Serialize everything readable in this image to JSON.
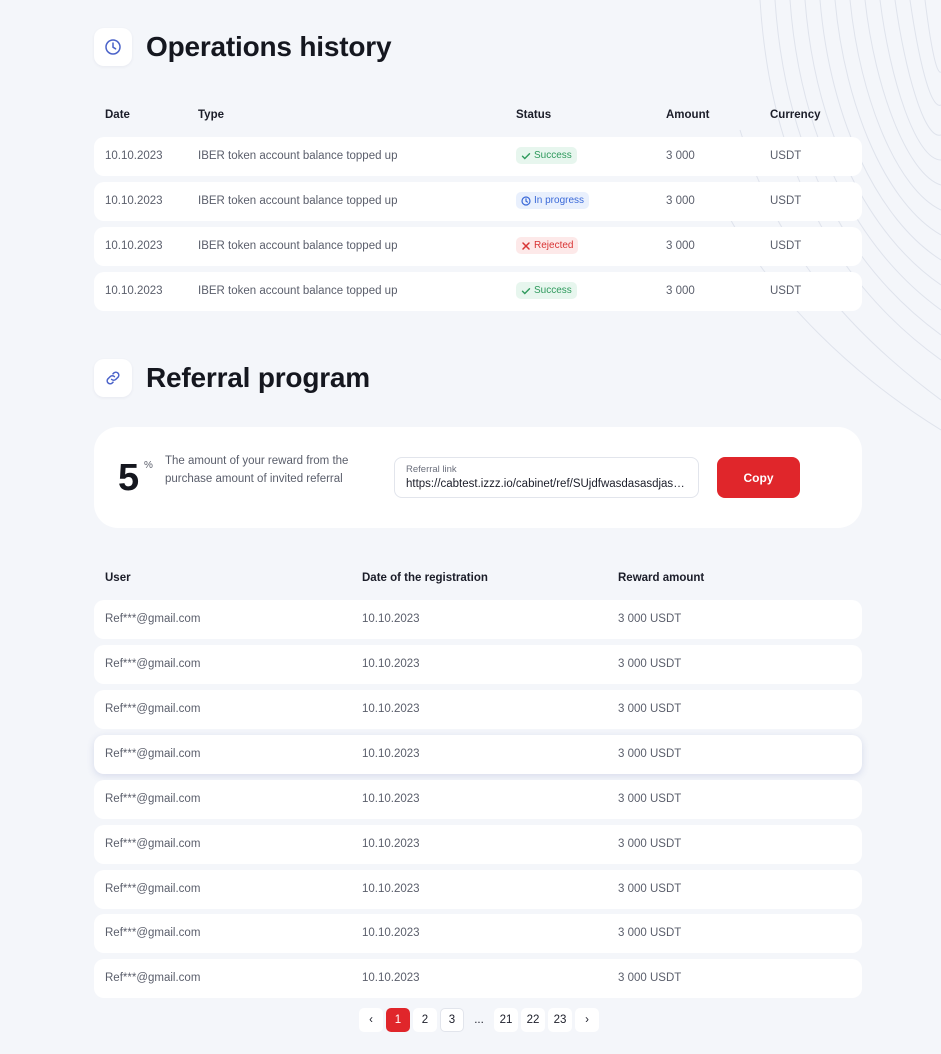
{
  "operations": {
    "title": "Operations history",
    "columns": {
      "date": "Date",
      "type": "Type",
      "status": "Status",
      "amount": "Amount",
      "currency": "Currency"
    },
    "rows": [
      {
        "date": "10.10.2023",
        "type": "IBER token account balance topped up",
        "status": "Success",
        "status_kind": "success",
        "amount": "3 000",
        "currency": "USDT"
      },
      {
        "date": "10.10.2023",
        "type": "IBER token account balance topped up",
        "status": "In progress",
        "status_kind": "progress",
        "amount": "3 000",
        "currency": "USDT"
      },
      {
        "date": "10.10.2023",
        "type": "IBER token account balance topped up",
        "status": "Rejected",
        "status_kind": "rejected",
        "amount": "3 000",
        "currency": "USDT"
      },
      {
        "date": "10.10.2023",
        "type": "IBER token account balance topped up",
        "status": "Success",
        "status_kind": "success",
        "amount": "3 000",
        "currency": "USDT"
      }
    ]
  },
  "referral": {
    "title": "Referral program",
    "percent": "5",
    "percent_sign": "%",
    "description": "The amount of your reward from the purchase amount of invited referral",
    "link_label": "Referral link",
    "link_value": "https://cabtest.izzz.io/cabinet/ref/SUjdfwasdasasdjasdkjasdkjas",
    "copy_label": "Copy",
    "columns": {
      "user": "User",
      "date": "Date of the registration",
      "reward": "Reward amount"
    },
    "rows": [
      {
        "user": "Ref***@gmail.com",
        "date": "10.10.2023",
        "reward": "3 000 USDT"
      },
      {
        "user": "Ref***@gmail.com",
        "date": "10.10.2023",
        "reward": "3 000 USDT"
      },
      {
        "user": "Ref***@gmail.com",
        "date": "10.10.2023",
        "reward": "3 000 USDT"
      },
      {
        "user": "Ref***@gmail.com",
        "date": "10.10.2023",
        "reward": "3 000 USDT"
      },
      {
        "user": "Ref***@gmail.com",
        "date": "10.10.2023",
        "reward": "3 000 USDT"
      },
      {
        "user": "Ref***@gmail.com",
        "date": "10.10.2023",
        "reward": "3 000 USDT"
      },
      {
        "user": "Ref***@gmail.com",
        "date": "10.10.2023",
        "reward": "3 000 USDT"
      },
      {
        "user": "Ref***@gmail.com",
        "date": "10.10.2023",
        "reward": "3 000 USDT"
      },
      {
        "user": "Ref***@gmail.com",
        "date": "10.10.2023",
        "reward": "3 000 USDT"
      }
    ]
  },
  "pagination": {
    "prev": "‹",
    "next": "›",
    "pages": [
      "1",
      "2",
      "3",
      "...",
      "21",
      "22",
      "23"
    ],
    "current": "1"
  },
  "colors": {
    "accent": "#e0262b",
    "success": "#2f9a5d",
    "progress": "#3a69d8",
    "rejected": "#d83434"
  }
}
